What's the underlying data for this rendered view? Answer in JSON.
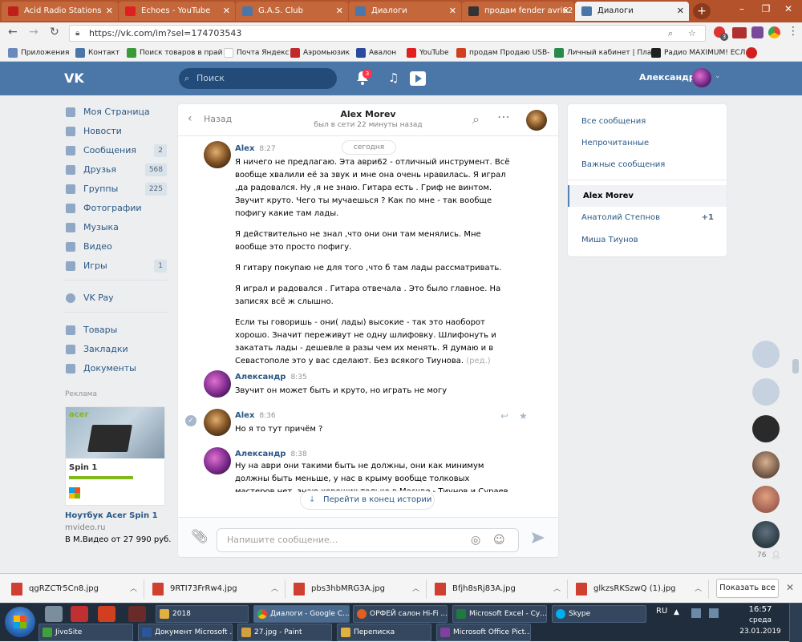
{
  "browser": {
    "tabs": [
      {
        "label": "Acid Radio Stations",
        "active": false
      },
      {
        "label": "Echoes - YouTube",
        "active": false
      },
      {
        "label": "G.A.S. Club",
        "active": false
      },
      {
        "label": "Диалоги",
        "active": false
      },
      {
        "label": "продам fender avri62 7",
        "active": false
      },
      {
        "label": "Диалоги",
        "active": true
      }
    ],
    "url": "https://vk.com/im?sel=174703543",
    "profile_badge": "3",
    "bookmarks": [
      "Приложения",
      "Контакт",
      "Поиск товаров в прай",
      "Почта Яндекс",
      "Аэромьюзик",
      "Авалон",
      "YouTube",
      "продам Продаю USB-",
      "Личный кабинет | Пла",
      "Радио MAXIMUM! ЕСЛ"
    ]
  },
  "vk": {
    "search_placeholder": "Поиск",
    "notifications_count": "3",
    "user_name": "Александр"
  },
  "left_nav": {
    "items": [
      {
        "label": "Моя Страница",
        "count": ""
      },
      {
        "label": "Новости",
        "count": ""
      },
      {
        "label": "Сообщения",
        "count": "2"
      },
      {
        "label": "Друзья",
        "count": "568"
      },
      {
        "label": "Группы",
        "count": "225"
      },
      {
        "label": "Фотографии",
        "count": ""
      },
      {
        "label": "Музыка",
        "count": ""
      },
      {
        "label": "Видео",
        "count": ""
      },
      {
        "label": "Игры",
        "count": "1"
      },
      {
        "label": "VK Pay",
        "count": ""
      },
      {
        "label": "Товары",
        "count": ""
      },
      {
        "label": "Закладки",
        "count": ""
      },
      {
        "label": "Документы",
        "count": ""
      }
    ],
    "ad": {
      "heading": "Реклама",
      "banner_brand": "acer",
      "banner_product": "Spin 1",
      "title": "Ноутбук Acer Spin 1",
      "domain": "mvideo.ru",
      "price": "В М.Видео от 27 990 руб."
    }
  },
  "chat": {
    "back_label": "Назад",
    "peer_name": "Alex Morev",
    "peer_status": "был в сети 22 минуты назад",
    "date_separator": "сегодня",
    "messages": [
      {
        "author": "Alex",
        "time": "8:27",
        "paragraphs": [
          "Я ничего не предлагаю. Эта аври62 - отличный инструмент. Всё вообще хвалили её за звук и мне она очень нравилась. Я играл ,да радовался. Ну ,я не знаю. Гитара есть . Гриф не винтом. Звучит круто. Чего ты мучаешься ? Как по мне - так вообще пофигу какие там лады.",
          "Я действительно не знал ,что они они там менялись. Мне вообще это просто пофигу.",
          "Я гитару покупаю не для того ,что б там лады рассматривать.",
          "Я играл и радовался . Гитара отвечала . Это было главное. На записях всё ж слышно.",
          "Если ты говоришь - они( лады) высокие - так это наоборот хорошо. Значит переживут не одну шлифовку. Шлифонуть и закатать лады - дешевле в разы чем их менять. Я думаю и в Севастополе это у вас сделают. Без всякого Тиунова."
        ],
        "edited": "(ред.)"
      },
      {
        "author": "Александр",
        "time": "8:35",
        "paragraphs": [
          "Звучит он может быть и круто, но играть не могу"
        ]
      },
      {
        "author": "Alex",
        "time": "8:36",
        "paragraphs": [
          "Но я то тут причём ?"
        ]
      },
      {
        "author": "Александр",
        "time": "8:38",
        "paragraphs": [
          "Ну на аври они такими быть не должны, они как минимум должны быть меньше, у нас в крыму вообще толковых мастеров нет, знаю хороших только в Москве - Тиунов и Сураев, у Тиунова уже нормально сделали лады, может и ты"
        ]
      }
    ],
    "jump_label": "Перейти в конец истории",
    "input_placeholder": "Напишите сообщение..."
  },
  "right_panel": {
    "items": [
      {
        "label": "Все сообщения",
        "badge": ""
      },
      {
        "label": "Непрочитанные",
        "badge": ""
      },
      {
        "label": "Важные сообщения",
        "badge": ""
      },
      {
        "label": "Alex Morev",
        "badge": ""
      },
      {
        "label": "Анатолий Степнов",
        "badge": "+1"
      },
      {
        "label": "Миша Тиунов",
        "badge": ""
      }
    ],
    "active_index": 3
  },
  "floating": {
    "online_count": "76"
  },
  "downloads": {
    "files": [
      "qgRZCTr5Cn8.jpg",
      "9RTI73FrRw4.jpg",
      "pbs3hbMRG3A.jpg",
      "Bfjh8sRj83A.jpg",
      "glkzsRKSzwQ (1).jpg"
    ],
    "show_all": "Показать все"
  },
  "taskbar": {
    "row1": [
      "2018",
      "Диалоги - Google C...",
      "ОРФЕЙ салон Hi-Fi ...",
      "Microsoft Excel - Су...",
      "Skype"
    ],
    "row2": [
      "JivoSite",
      "Документ Microsoft ...",
      "27.jpg - Paint",
      "Переписка",
      "Microsoft Office Pict..."
    ],
    "lang": "RU",
    "time": "16:57",
    "day": "среда",
    "date": "23.01.2019"
  },
  "colors": {
    "vk_blue": "#4a76a8",
    "link": "#2a5885",
    "chrome_tabstrip": "#b4522c",
    "taskbar": "#1f2d3d"
  }
}
